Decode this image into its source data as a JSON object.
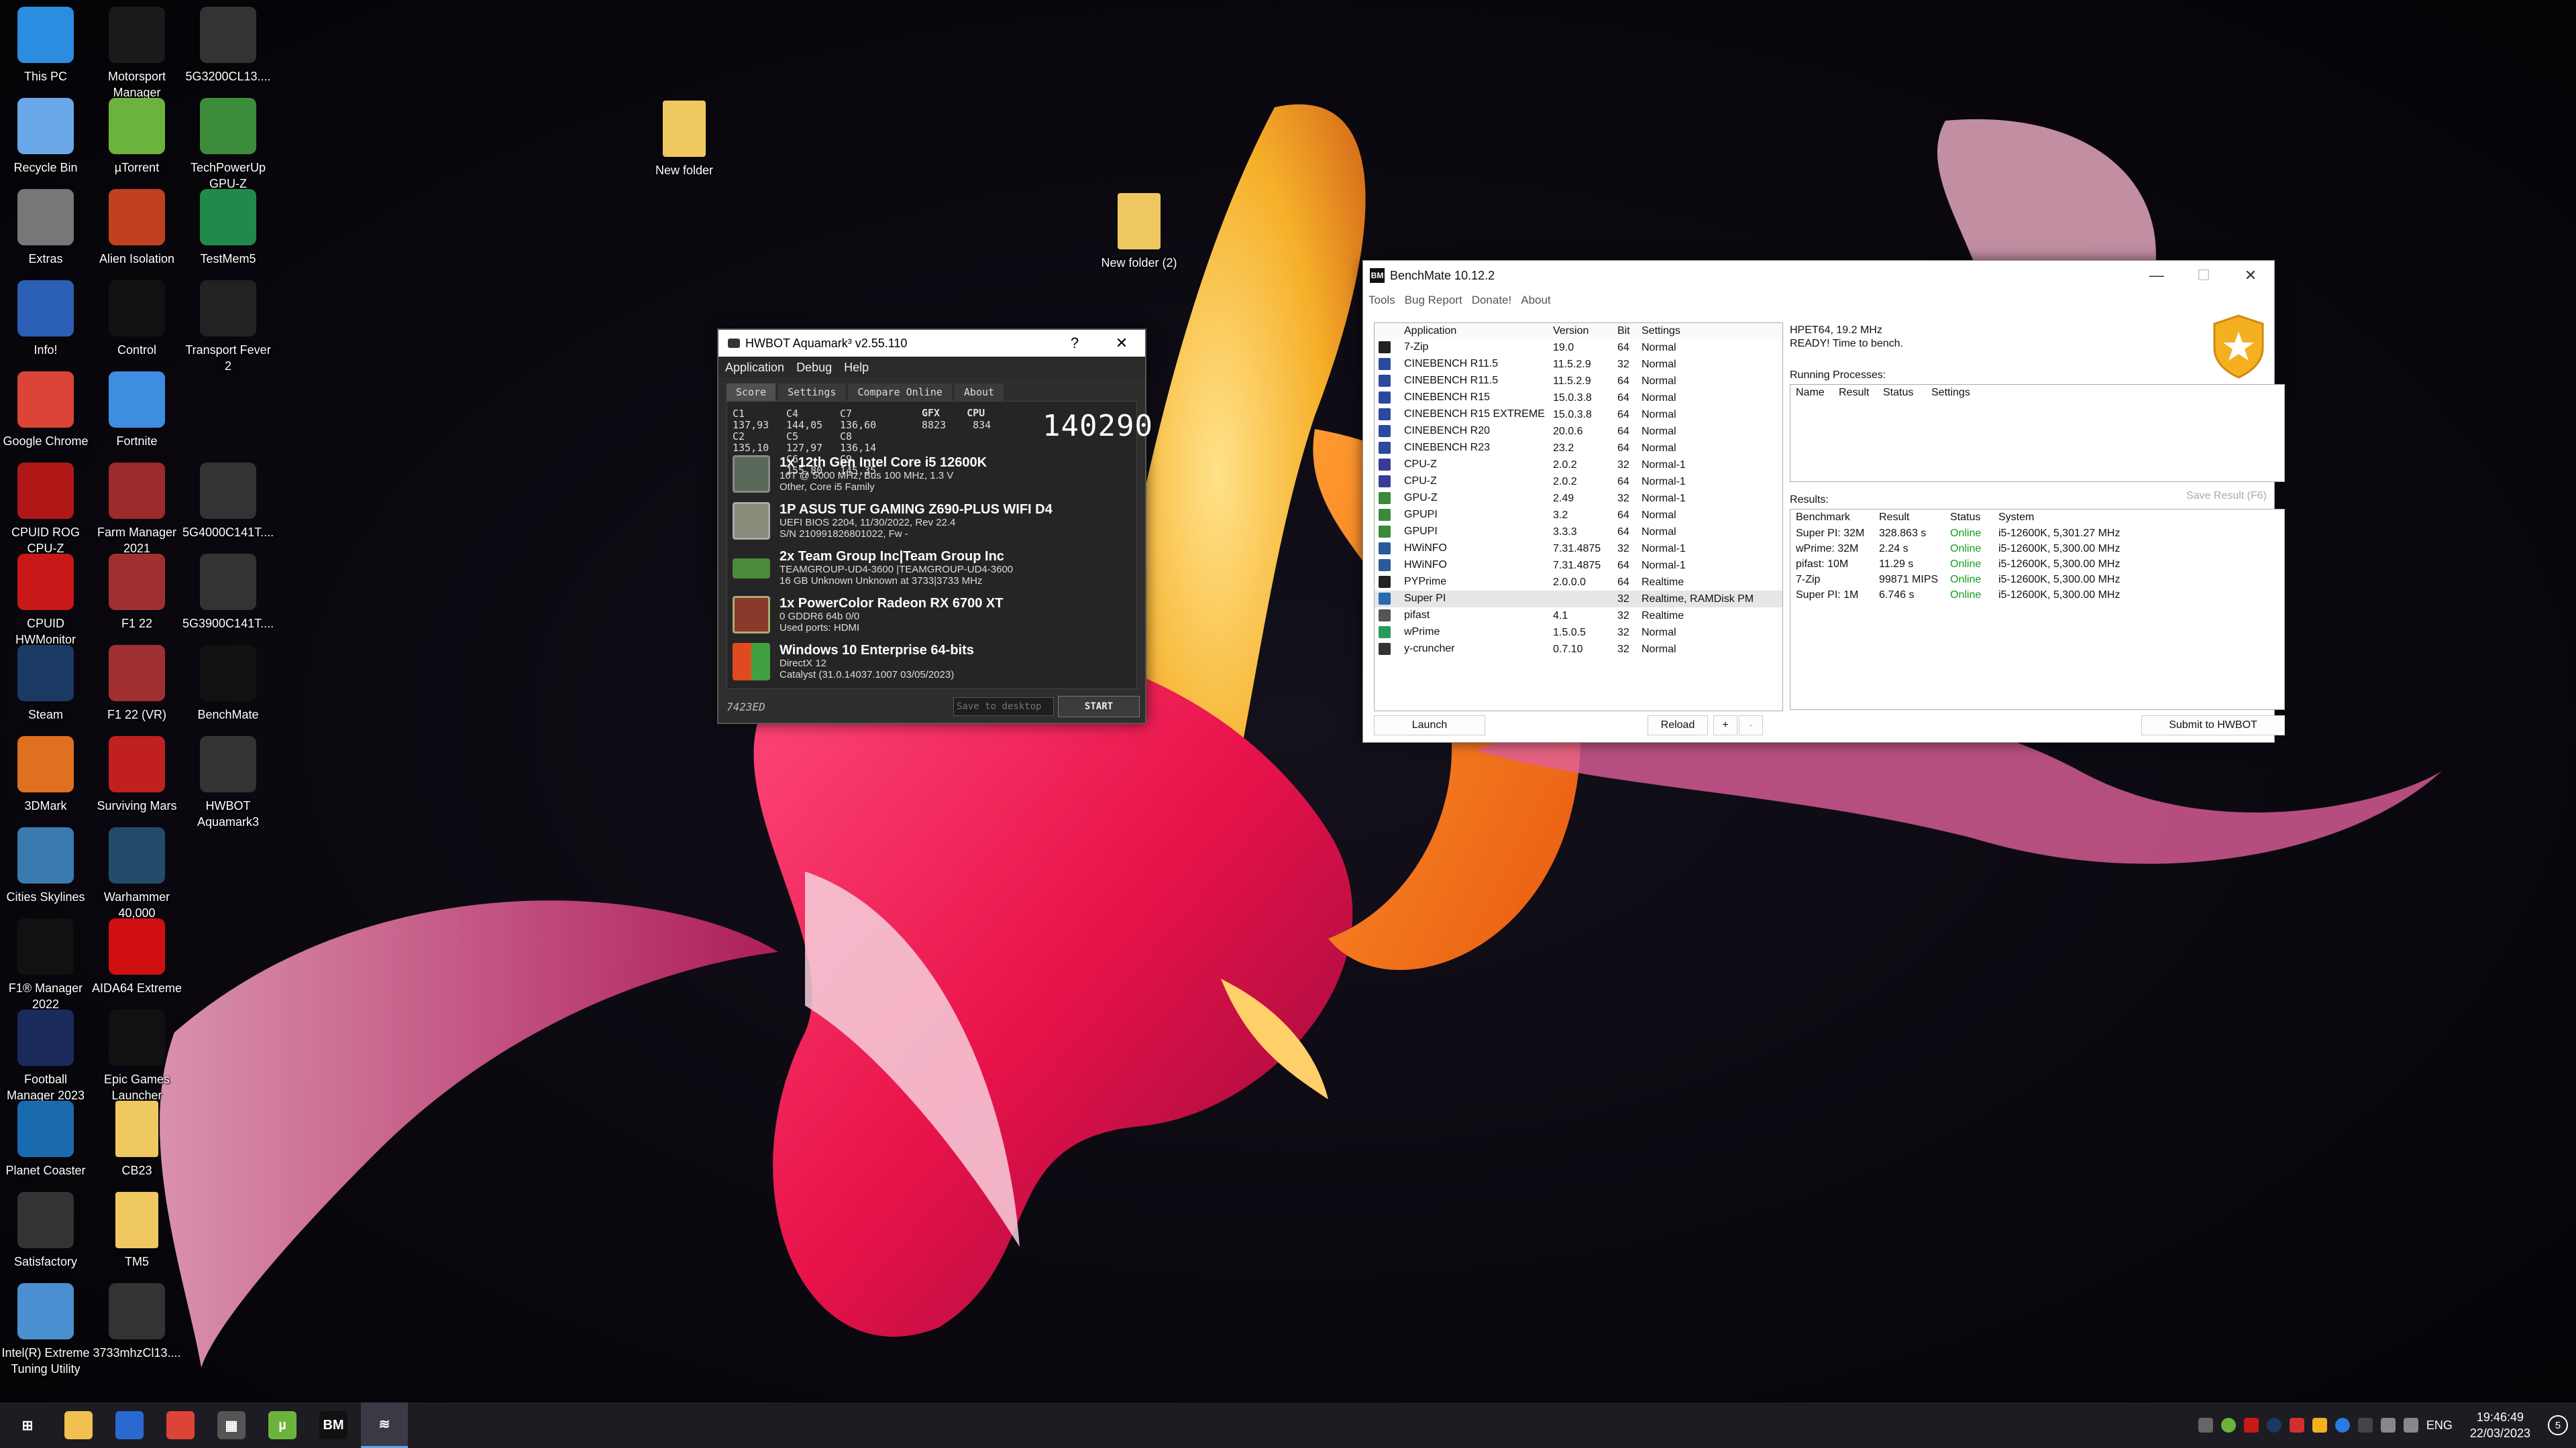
{
  "desktop_icons": [
    {
      "label": "This PC",
      "icon": "monitor-icon",
      "color": "#2b8de0"
    },
    {
      "label": "Motorsport Manager",
      "icon": "mm-logo-icon",
      "color": "#1a1a1a"
    },
    {
      "label": "5G3200CL13....",
      "icon": "bike-icon",
      "color": "#333"
    },
    {
      "label": "Recycle Bin",
      "icon": "recycle-bin-icon",
      "color": "#6aa7e8"
    },
    {
      "label": "µTorrent",
      "icon": "utorrent-icon",
      "color": "#6cb33e"
    },
    {
      "label": "TechPowerUp GPU-Z",
      "icon": "gpuz-icon",
      "color": "#3c8c3c"
    },
    {
      "label": "Extras",
      "icon": "extras-icon",
      "color": "#777"
    },
    {
      "label": "Alien Isolation",
      "icon": "alien-icon",
      "color": "#c04020"
    },
    {
      "label": "TestMem5",
      "icon": "ram-icon",
      "color": "#1f8a4a"
    },
    {
      "label": "Info!",
      "icon": "info-swirl-icon",
      "color": "#2a5fb5"
    },
    {
      "label": "Control",
      "icon": "control-icon",
      "color": "#111"
    },
    {
      "label": "Transport Fever 2",
      "icon": "tf-icon",
      "color": "#222"
    },
    {
      "label": "Google Chrome",
      "icon": "chrome-icon",
      "color": "#db4437"
    },
    {
      "label": "Fortnite",
      "icon": "fortnite-icon",
      "color": "#3d8de0"
    },
    {
      "label": "CPUID ROG CPU-Z",
      "icon": "rog-cpuz-icon",
      "color": "#b01818"
    },
    {
      "label": "Farm Manager 2021",
      "icon": "barn-icon",
      "color": "#9c2a2a"
    },
    {
      "label": "5G4000C141T....",
      "icon": "bike-icon",
      "color": "#333"
    },
    {
      "label": "CPUID HWMonitor",
      "icon": "hwmonitor-icon",
      "color": "#c81818"
    },
    {
      "label": "F1 22",
      "icon": "f1-22-icon",
      "color": "#a03030"
    },
    {
      "label": "5G3900C141T....",
      "icon": "bike-icon",
      "color": "#333"
    },
    {
      "label": "Steam",
      "icon": "steam-icon",
      "color": "#1b3a63"
    },
    {
      "label": "F1 22 (VR)",
      "icon": "f1-22-vr-icon",
      "color": "#a03030"
    },
    {
      "label": "BenchMate",
      "icon": "benchmate-icon",
      "color": "#111"
    },
    {
      "label": "3DMark",
      "icon": "3dmark-icon",
      "color": "#e07020"
    },
    {
      "label": "Surviving Mars",
      "icon": "mars-icon",
      "color": "#c02020"
    },
    {
      "label": "HWBOT Aquamark3",
      "icon": "aquamark-icon",
      "color": "#333"
    },
    {
      "label": "Cities Skylines",
      "icon": "cities-icon",
      "color": "#3a7ab0"
    },
    {
      "label": "Warhammer 40,000 Gladius...",
      "icon": "warhammer-icon",
      "color": "#244a6a"
    },
    {
      "label": "F1® Manager 2022",
      "icon": "f1-manager-icon",
      "color": "#111"
    },
    {
      "label": "AIDA64 Extreme",
      "icon": "aida64-icon",
      "color": "#d01010"
    },
    {
      "label": "Football Manager 2023",
      "icon": "fm23-icon",
      "color": "#1a2a5a"
    },
    {
      "label": "Epic Games Launcher",
      "icon": "epic-icon",
      "color": "#111"
    },
    {
      "label": "Planet Coaster",
      "icon": "coaster-icon",
      "color": "#1a6ab0"
    },
    {
      "label": "CB23",
      "icon": "folder-icon",
      "color": "#f0c860"
    },
    {
      "label": "Satisfactory",
      "icon": "satisfactory-icon",
      "color": "#333"
    },
    {
      "label": "TM5",
      "icon": "folder-icon",
      "color": "#f0c860"
    },
    {
      "label": "Intel(R) Extreme Tuning Utility",
      "icon": "xtu-icon",
      "color": "#4a90d0"
    },
    {
      "label": "3733mhzCl13....",
      "icon": "bike-icon",
      "color": "#333"
    },
    {
      "label": "New folder",
      "icon": "folder-icon",
      "color": "#f0c860"
    },
    {
      "label": "New folder (2)",
      "icon": "folder-icon",
      "color": "#f0c860"
    }
  ],
  "aquamark": {
    "title": "HWBOT Aquamark³ v2.55.110",
    "help_btn": "?",
    "close_btn": "✕",
    "menu": [
      "Application",
      "Debug",
      "Help"
    ],
    "tabs": [
      "Score",
      "Settings",
      "Compare Online",
      "About"
    ],
    "scores": [
      "C1 137,93",
      "C4 144,05",
      "C7 136,60",
      "C2 135,10",
      "C5 127,97",
      "C8 136,14",
      "C3 142,63",
      "C6 155,80",
      "C9 145,35"
    ],
    "gfx_label": "GFX",
    "cpu_label": "CPU",
    "gfx_value": "8823",
    "cpu_value": "834",
    "total": "140290",
    "hardware": [
      {
        "title": "1x 12th Gen Intel Core i5 12600K",
        "lines": [
          "16T @ 5000 MHz, Bus 100 MHz, 1.3 V",
          "Other, Core i5 Family"
        ]
      },
      {
        "title": "1P ASUS TUF GAMING Z690-PLUS WIFI D4",
        "lines": [
          "UEFI BIOS 2204, 11/30/2022, Rev 22.4",
          "S/N 210991826801022, Fw -"
        ]
      },
      {
        "title": "2x Team Group Inc|Team Group Inc",
        "lines": [
          "TEAMGROUP-UD4-3600 |TEAMGROUP-UD4-3600",
          "16 GB Unknown Unknown at 3733|3733 MHz"
        ]
      },
      {
        "title": "1x PowerColor Radeon RX 6700 XT",
        "lines": [
          "0 GDDR6 64b 0/0",
          "Used ports: HDMI"
        ]
      },
      {
        "title": "Windows 10 Enterprise 64-bits",
        "lines": [
          "DirectX 12",
          "Catalyst (31.0.14037.1007 03/05/2023)"
        ]
      }
    ],
    "code": "7423ED",
    "save_placeholder": "Save to desktop",
    "start": "START"
  },
  "benchmate": {
    "title": "BenchMate 10.12.2",
    "menu": [
      "Tools",
      "Bug Report",
      "Donate!",
      "About"
    ],
    "app_headers": [
      "Application",
      "Version",
      "Bit",
      "Settings"
    ],
    "apps": [
      [
        "7-Zip",
        "19.0",
        "64",
        "Normal"
      ],
      [
        "CINEBENCH R11.5",
        "11.5.2.9",
        "32",
        "Normal"
      ],
      [
        "CINEBENCH R11.5",
        "11.5.2.9",
        "64",
        "Normal"
      ],
      [
        "CINEBENCH R15",
        "15.0.3.8",
        "64",
        "Normal"
      ],
      [
        "CINEBENCH R15 EXTREME",
        "15.0.3.8",
        "64",
        "Normal"
      ],
      [
        "CINEBENCH R20",
        "20.0.6",
        "64",
        "Normal"
      ],
      [
        "CINEBENCH R23",
        "23.2",
        "64",
        "Normal"
      ],
      [
        "CPU-Z",
        "2.0.2",
        "32",
        "Normal-1"
      ],
      [
        "CPU-Z",
        "2.0.2",
        "64",
        "Normal-1"
      ],
      [
        "GPU-Z",
        "2.49",
        "32",
        "Normal-1"
      ],
      [
        "GPUPI",
        "3.2",
        "64",
        "Normal"
      ],
      [
        "GPUPI",
        "3.3.3",
        "64",
        "Normal"
      ],
      [
        "HWiNFO",
        "7.31.4875",
        "32",
        "Normal-1"
      ],
      [
        "HWiNFO",
        "7.31.4875",
        "64",
        "Normal-1"
      ],
      [
        "PYPrime",
        "2.0.0.0",
        "64",
        "Realtime"
      ],
      [
        "Super PI",
        "",
        "32",
        "Realtime, RAMDisk PM"
      ],
      [
        "pifast",
        "4.1",
        "32",
        "Realtime"
      ],
      [
        "wPrime",
        "1.5.0.5",
        "32",
        "Normal"
      ],
      [
        "y-cruncher",
        "0.7.10",
        "32",
        "Normal"
      ]
    ],
    "selected_row": 15,
    "info_line1": "HPET64, 19.2 MHz",
    "info_line2": "READY! Time to bench.",
    "running_label": "Running Processes:",
    "running_headers": [
      "Name",
      "Result",
      "Status",
      "Settings"
    ],
    "save_result": "Save Result (F6)",
    "results_label": "Results:",
    "result_headers": [
      "Benchmark",
      "Result",
      "Status",
      "System"
    ],
    "results": [
      [
        "Super PI: 32M",
        "328.863 s",
        "Online",
        "i5-12600K, 5,301.27 MHz"
      ],
      [
        "wPrime: 32M",
        "2.24 s",
        "Online",
        "i5-12600K, 5,300.00 MHz"
      ],
      [
        "pifast: 10M",
        "11.29 s",
        "Online",
        "i5-12600K, 5,300.00 MHz"
      ],
      [
        "7-Zip",
        "99871 MIPS",
        "Online",
        "i5-12600K, 5,300.00 MHz"
      ],
      [
        "Super PI: 1M",
        "6.746 s",
        "Online",
        "i5-12600K, 5,300.00 MHz"
      ]
    ],
    "launch": "Launch",
    "reload": "Reload",
    "plus": "+",
    "minus": "-",
    "submit": "Submit to HWBOT",
    "min_btn": "—",
    "max_btn": "☐",
    "close_btn": "✕"
  },
  "taskbar": {
    "items": [
      {
        "name": "start-button",
        "icon": "windows-icon",
        "color": "#1c1c22",
        "glyph": "⊞"
      },
      {
        "name": "file-explorer",
        "icon": "folder-icon",
        "color": "#f0c050",
        "glyph": ""
      },
      {
        "name": "ms-store",
        "icon": "store-icon",
        "color": "#2a6ad0",
        "glyph": ""
      },
      {
        "name": "chrome",
        "icon": "chrome-icon",
        "color": "#db4437",
        "glyph": ""
      },
      {
        "name": "calculator",
        "icon": "calculator-icon",
        "color": "#555",
        "glyph": "▦"
      },
      {
        "name": "utorrent",
        "icon": "utorrent-icon",
        "color": "#6cb33e",
        "glyph": "µ"
      },
      {
        "name": "benchmate",
        "icon": "benchmate-icon",
        "color": "#111",
        "glyph": "BM"
      },
      {
        "name": "aquamark",
        "icon": "aquamark-icon",
        "color": "#3a3a44",
        "glyph": "≋"
      }
    ],
    "lang": "ENG",
    "time": "19:46:49",
    "date": "22/03/2023",
    "notif": "5"
  }
}
